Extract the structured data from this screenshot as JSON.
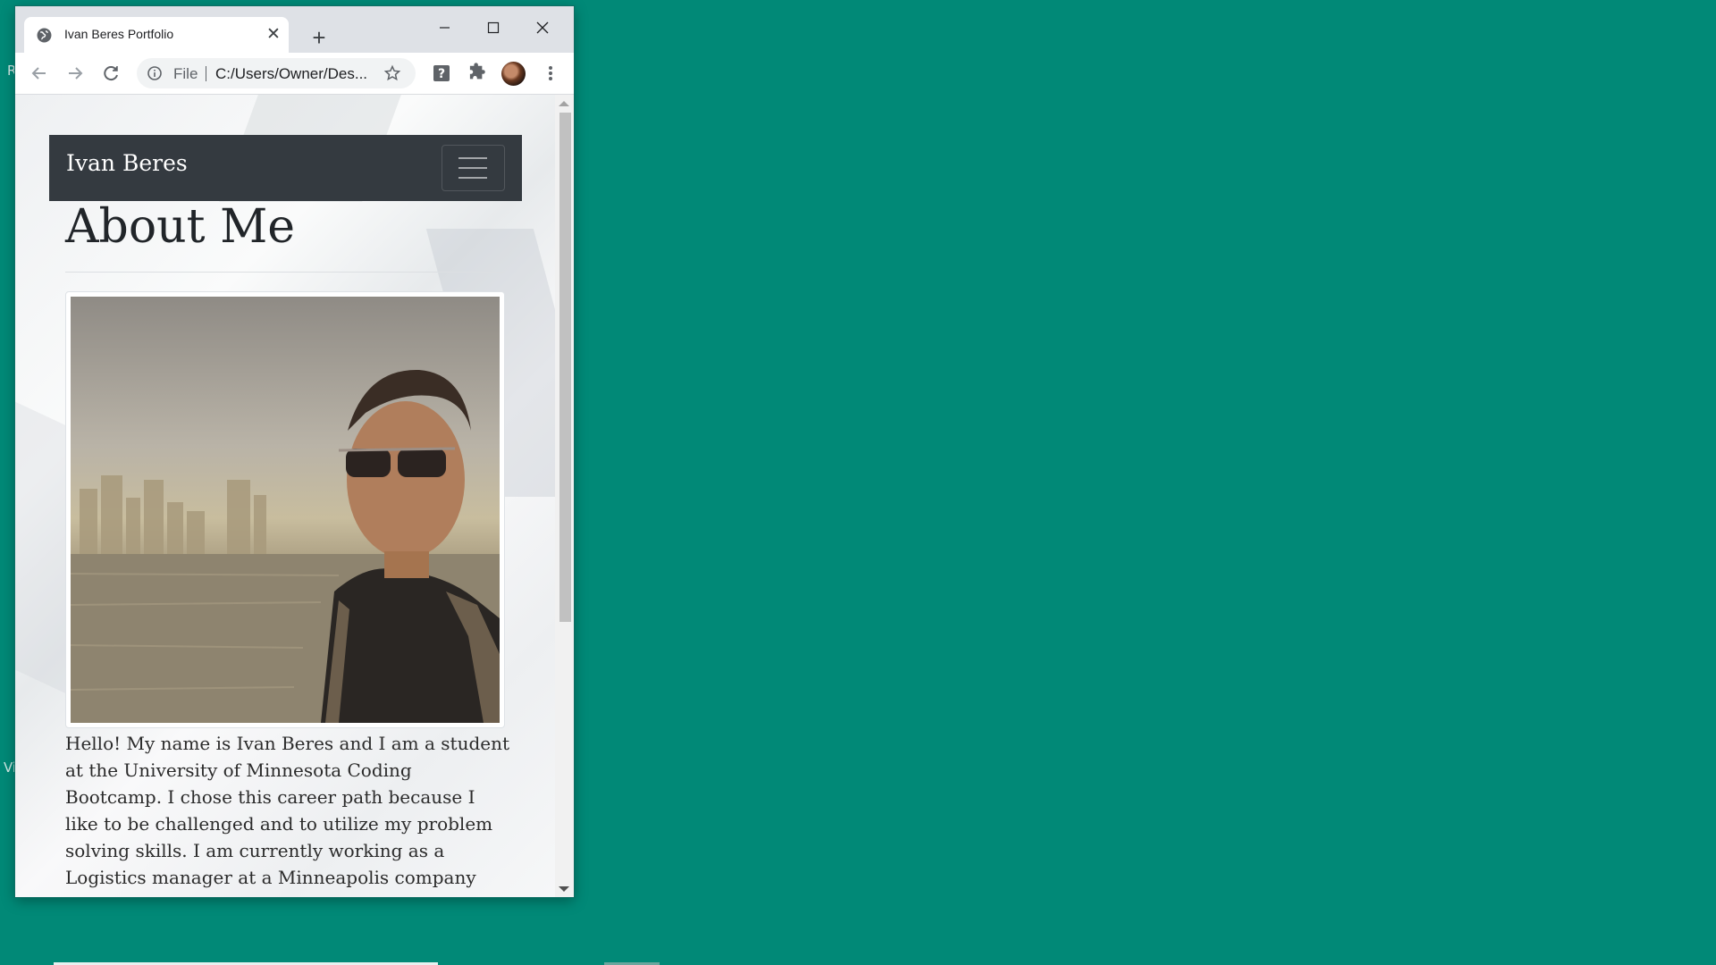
{
  "desktop": {
    "edge_glyph_top": "R",
    "edge_glyph_bottom": "Vi"
  },
  "browser": {
    "tab_title": "Ivan Beres Portfolio",
    "omnibox_scheme": "File",
    "omnibox_url": "C:/Users/Owner/Des...",
    "icons": {
      "favicon": "globe-icon",
      "close_tab": "close-icon",
      "new_tab": "plus-icon",
      "minimize": "minimize-icon",
      "maximize": "maximize-icon",
      "close_window": "close-icon",
      "back": "arrow-left-icon",
      "forward": "arrow-right-icon",
      "reload": "reload-icon",
      "info": "info-icon",
      "bookmark": "star-icon",
      "help_extension": "help-icon",
      "extensions": "puzzle-icon",
      "menu": "kebab-icon"
    }
  },
  "page": {
    "brand": "Ivan Beres",
    "heading": "About Me",
    "bio": "Hello! My name is Ivan Beres and I am a student at the University of Minnesota Coding Bootcamp. I chose this career path because I like to be challenged and to utilize my problem solving skills. I am currently working as a Logistics manager at a Minneapolis company called Jume Co. I live in Minneapolis with my wife Jennifer and two kids Maksymilian and Ellington."
  },
  "colors": {
    "desktop": "#018977",
    "navbar": "#343a40",
    "tabstrip": "#dee1e6"
  }
}
